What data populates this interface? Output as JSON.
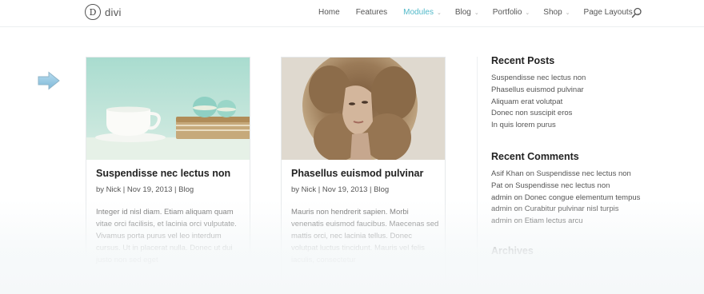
{
  "brand": {
    "logo_letter": "D",
    "name": "divi"
  },
  "nav": {
    "items": [
      {
        "label": "Home",
        "dropdown": false
      },
      {
        "label": "Features",
        "dropdown": false
      },
      {
        "label": "Modules",
        "dropdown": true,
        "active": true
      },
      {
        "label": "Blog",
        "dropdown": true
      },
      {
        "label": "Portfolio",
        "dropdown": true
      },
      {
        "label": "Shop",
        "dropdown": true
      },
      {
        "label": "Page Layouts",
        "dropdown": true
      }
    ],
    "caret": "⌄",
    "active_color": "#52b9c9"
  },
  "posts": [
    {
      "title": "Suspendisse nec lectus non",
      "author": "Nick",
      "date": "Nov 19, 2013",
      "category": "Blog",
      "meta": "by Nick | Nov 19, 2013 | Blog",
      "excerpt": "Integer id nisl diam. Etiam aliquam quam vitae orci facilisis, et lacinia orci vulputate. Vivamus porta purus vel leo interdum cursus. Ut in placerat nulla. Donec ut dui justo non sed eget"
    },
    {
      "title": "Phasellus euismod pulvinar",
      "author": "Nick",
      "date": "Nov 19, 2013",
      "category": "Blog",
      "meta": "by Nick | Nov 19, 2013 | Blog",
      "excerpt": "Mauris non hendrerit sapien. Morbi venenatis euismod faucibus. Maecenas sed mattis orci, nec lacinia tellus. Donec volutpat luctus tincidunt. Mauris vel felis iaculis, consectetur"
    }
  ],
  "sidebar": {
    "recent_posts": {
      "title": "Recent Posts",
      "items": [
        "Suspendisse nec lectus non",
        "Phasellus euismod pulvinar",
        "Aliquam erat volutpat",
        "Donec non suscipit eros",
        "In quis lorem purus"
      ]
    },
    "recent_comments": {
      "title": "Recent Comments",
      "items": [
        "Asif Khan on Suspendisse nec lectus non",
        "Pat on Suspendisse nec lectus non",
        "admin on Donec congue elementum tempus",
        "admin on Curabitur pulvinar nisl turpis",
        "admin on Etiam lectus arcu"
      ]
    },
    "archives": {
      "title": "Archives"
    }
  },
  "icons": {
    "search": "search-icon",
    "arrow": "arrow-right-icon"
  }
}
